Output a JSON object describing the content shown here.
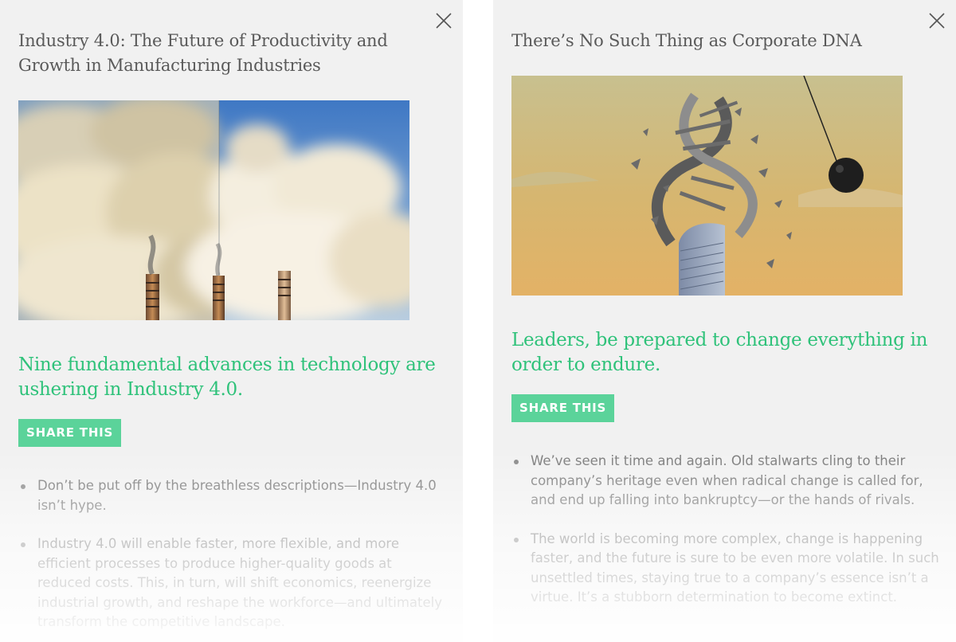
{
  "left_card": {
    "title": "Industry 4.0: The Future of Productivity and Growth in Manufacturing Industries",
    "hero_image": "smokestacks-clouds-illustration",
    "tagline": "Nine fundamental advances in technology are ushering in Industry 4.0.",
    "share_label": "SHARE THIS",
    "bullets": [
      "Don’t be put off by the breathless descriptions—Industry 4.0 isn’t hype.",
      "Industry 4.0 will enable faster, more flexible, and more efficient processes to produce higher-quality goods at reduced costs. This, in turn, will shift economics, reenergize industrial growth, and reshape the workforce—and ultimately transform the competitive landscape."
    ],
    "close_icon": "close-icon"
  },
  "right_card": {
    "title": "There’s No Such Thing as Corporate DNA",
    "hero_image": "dna-helix-wrecking-ball-illustration",
    "tagline": "Leaders, be prepared to change everything in order to endure.",
    "share_label": "SHARE THIS",
    "bullets": [
      "We’ve seen it time and again. Old stalwarts cling to their company’s heritage even when radical change is called for, and end up falling into bankruptcy—or the hands of rivals.",
      "The world is becoming more complex, change is happening faster, and the future is sure to be even more volatile. In such unsettled times, staying true to a company’s essence isn’t a virtue. It’s a stubborn determination to become extinct."
    ],
    "close_icon": "close-icon"
  },
  "colors": {
    "accent_green": "#2fc27a",
    "share_button": "#5bd39a",
    "panel_bg": "#f1f1f1",
    "title_text": "#5a5a5a"
  }
}
